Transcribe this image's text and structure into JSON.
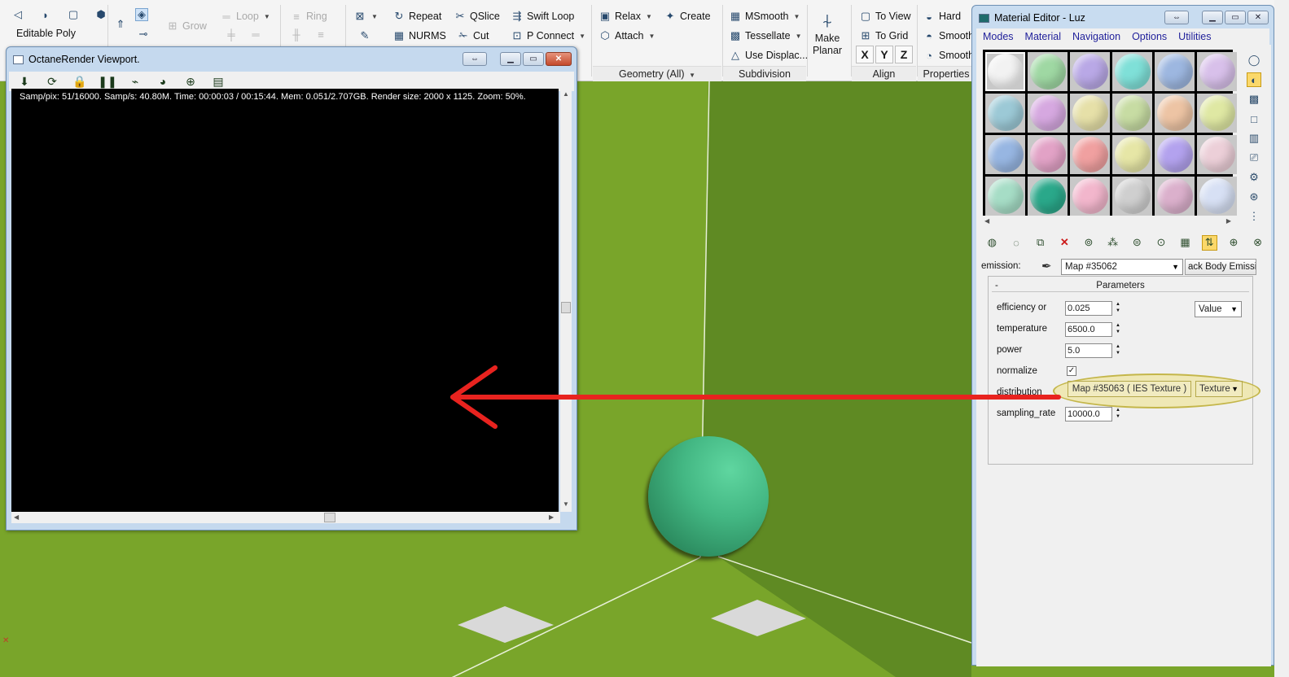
{
  "ribbon": {
    "editable_poly": "Editable Poly",
    "grow": "Grow",
    "loop": "Loop",
    "ring": "Ring",
    "repeat": "Repeat",
    "qslice": "QSlice",
    "swift_loop": "Swift Loop",
    "nurms": "NURMS",
    "cut": "Cut",
    "p_connect": "P Connect",
    "relax": "Relax",
    "create": "Create",
    "attach": "Attach",
    "msmooth": "MSmooth",
    "tessellate": "Tessellate",
    "use_displace": "Use Displac...",
    "make_planar_1": "Make",
    "make_planar_2": "Planar",
    "to_view": "To View",
    "to_grid": "To Grid",
    "axis_x": "X",
    "axis_y": "Y",
    "axis_z": "Z",
    "hard": "Hard",
    "smooth": "Smooth",
    "smooth30": "Smooth",
    "group_geometry": "Geometry (All)",
    "group_subdivision": "Subdivision",
    "group_align": "Align",
    "group_properties": "Properties"
  },
  "octane": {
    "title": "OctaneRender Viewport.",
    "status": "Samp/pix: 51/16000.   Samp/s: 40.80M.   Time: 00:00:03 / 00:15:44.   Mem: 0.051/2.707GB.   Render size: 2000 x 1125.   Zoom: 50%."
  },
  "material_editor": {
    "title": "Material Editor - Luz",
    "menus": [
      "Modes",
      "Material",
      "Navigation",
      "Options",
      "Utilities"
    ],
    "emission_label": "emission:",
    "emission_map": "Map #35062",
    "emission_type": "ack Body Emission",
    "params_title": "Parameters",
    "params_collapse": "-",
    "rows": {
      "efficiency_label": "efficiency or",
      "efficiency_value": "0.025",
      "efficiency_mode": "Value",
      "temperature_label": "temperature",
      "temperature_value": "6500.0",
      "power_label": "power",
      "power_value": "5.0",
      "normalize_label": "normalize",
      "normalize_check": "✓",
      "distribution_label": "distribution",
      "distribution_map": "Map #35063  ( IES Texture )",
      "distribution_mode": "Texture",
      "sampling_label": "sampling_rate",
      "sampling_value": "10000.0"
    },
    "slot_colors": [
      "#f2f2f2",
      "#9fd8a3",
      "#b9a8e6",
      "#7fe0d8",
      "#9db7e0",
      "#d8c0ea",
      "#9cc9d6",
      "#d6a8e0",
      "#e6e0a8",
      "#c7dca3",
      "#edc4a4",
      "#dfe8a3",
      "#97b6e2",
      "#e2a2c6",
      "#f0a0a0",
      "#e6e6a6",
      "#b3a2ee",
      "#eccfd8",
      "#a6ddc6",
      "#2aa88a",
      "#f2b6cc",
      "#cfcfcf",
      "#dbb0cc",
      "#d7e0f4"
    ]
  },
  "colors": {
    "accent_red": "#e8231f",
    "highlight": "#eee49b",
    "ground": "#79a52a"
  }
}
